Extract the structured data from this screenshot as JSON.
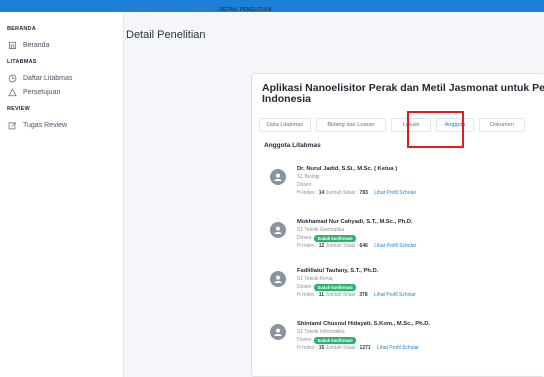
{
  "sidebar": {
    "sections": [
      {
        "title": "BERANDA",
        "items": [
          {
            "label": "Beranda",
            "icon": "home-icon"
          }
        ]
      },
      {
        "title": "LITABMAS",
        "items": [
          {
            "label": "Daftar Litabmas",
            "icon": "clock-icon"
          },
          {
            "label": "Persetujuan",
            "icon": "warning-icon"
          }
        ]
      },
      {
        "title": "REVIEW",
        "items": [
          {
            "label": "Tugas Review",
            "icon": "edit-icon"
          }
        ]
      }
    ]
  },
  "breadcrumb": {
    "items": [
      "LITABMAS",
      "DAFTAR LITABMAS",
      "DETAIL PENELITIAN"
    ],
    "separator": ">"
  },
  "page": {
    "title": "Detail Penelitian"
  },
  "card": {
    "title_line1": "Aplikasi Nanoelisitor Perak dan Metil Jasmonat untuk Pening",
    "title_line2": "Indonesia",
    "tabs": [
      "Data Litabmas",
      "Bidang dan Luaran",
      "Lokasi",
      "Anggota",
      "Dokumen"
    ],
    "active_tab": "Anggota",
    "section_title": "Anggota Litabmas"
  },
  "members": [
    {
      "name": "Dr. Nurul Jadid, S.Si., M.Sc. ( Ketua )",
      "program": "S1 Biologi",
      "role": "Dosen",
      "badge": "",
      "hindex": "14",
      "sitasi": "783"
    },
    {
      "name": "Mokhamad Nur Cahyadi, S.T., M.Sc., Ph.D.",
      "program": "S1 Teknik Geomatika",
      "role": "Dosen",
      "badge": "Sudah konfirmasi",
      "hindex": "12",
      "sitasi": "646"
    },
    {
      "name": "Fadlillatul Taufany, S.T., Ph.D.",
      "program": "S1 Teknik Kimia",
      "role": "Dosen",
      "badge": "Sudah konfirmasi",
      "hindex": "11",
      "sitasi": "378"
    },
    {
      "name": "Shintami Chusnul Hidayati, S.Kom., M.Sc., Ph.D.",
      "program": "S1 Teknik Informatika",
      "role": "Dosen",
      "badge": "Sudah konfirmasi",
      "hindex": "15",
      "sitasi": "1271"
    }
  ],
  "labels": {
    "hindex": "H-Index :",
    "sitasi": "Jumlah Sitasi :",
    "scholar_link": "Lihat Profil Scholar"
  },
  "colors": {
    "topbar": "#1e7fd8",
    "link": "#1e7fd8",
    "badge": "#2bb36b",
    "highlight": "#e01e1e"
  }
}
